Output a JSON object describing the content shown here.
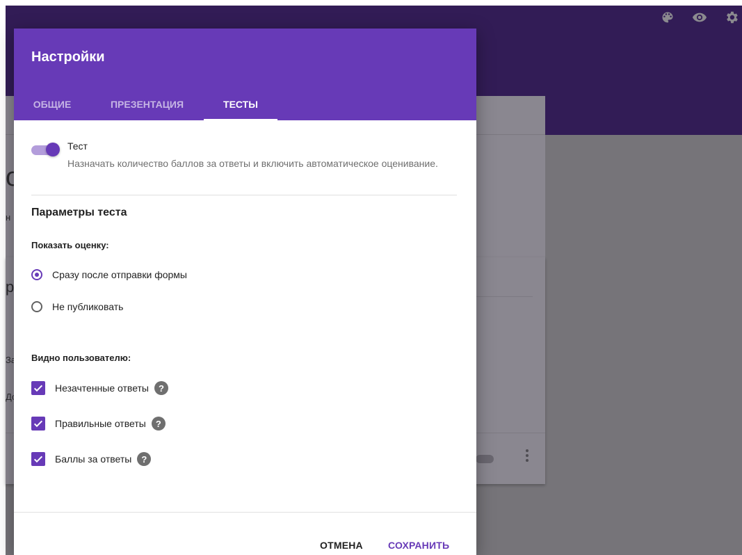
{
  "dialog": {
    "title": "Настройки",
    "tabs": [
      {
        "label": "ОБЩИЕ"
      },
      {
        "label": "ПРЕЗЕНТАЦИЯ"
      },
      {
        "label": "ТЕСТЫ",
        "active": true
      }
    ],
    "quiz_toggle": {
      "label": "Тест",
      "description": "Назначать количество баллов за ответы и включить автоматическое оценивание.",
      "enabled": true
    },
    "section_title": "Параметры теста",
    "show_grade": {
      "label": "Показать оценку:",
      "options": [
        {
          "label": "Сразу после отправки формы",
          "selected": true
        },
        {
          "label": "Не публиковать",
          "selected": false
        }
      ]
    },
    "visible_to_user": {
      "label": "Видно пользователю:",
      "options": [
        {
          "label": "Незачтенные ответы",
          "checked": true
        },
        {
          "label": "Правильные ответы",
          "checked": true
        },
        {
          "label": "Баллы за ответы",
          "checked": true
        }
      ]
    },
    "cancel_label": "ОТМЕНА",
    "save_label": "СОХРАНИТЬ"
  },
  "header_icons": [
    "palette-icon",
    "eye-icon",
    "gear-icon"
  ],
  "background_fragments": [
    "о",
    "н",
    "р",
    "За",
    "До"
  ],
  "colors": {
    "accent": "#673ab7",
    "header_bg": "#321c56",
    "overlay": "#767479"
  }
}
